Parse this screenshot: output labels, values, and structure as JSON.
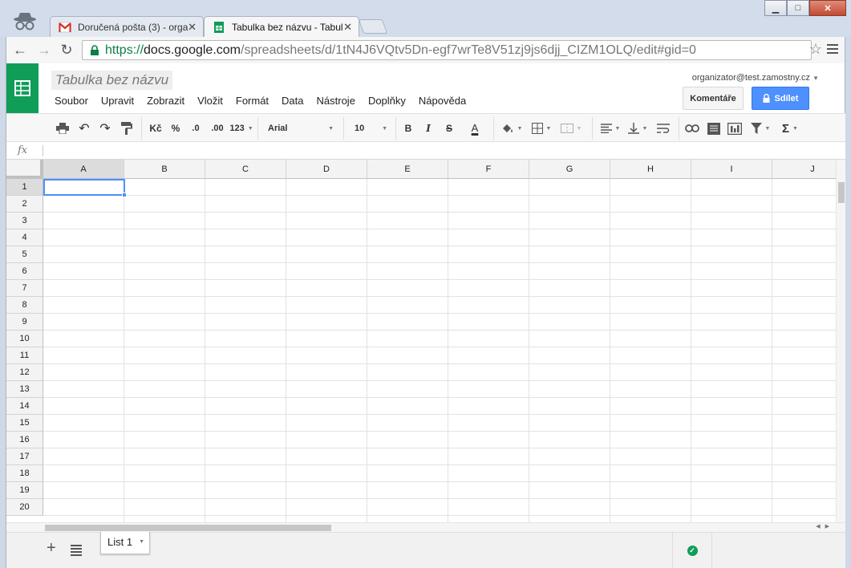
{
  "browser": {
    "tabs": [
      {
        "title": "Doručená pošta (3) - orga",
        "favicon": "gmail-icon"
      },
      {
        "title": "Tabulka bez názvu - Tabul",
        "favicon": "sheets-icon"
      }
    ],
    "url": {
      "scheme": "https://",
      "host": "docs.google.com",
      "path": "/spreadsheets/d/1tN4J6VQtv5Dn-egf7wrTe8V51zj9js6djj_CIZM1OLQ/edit#gid=0"
    }
  },
  "app": {
    "doc_title": "Tabulka bez názvu",
    "menu": [
      "Soubor",
      "Upravit",
      "Zobrazit",
      "Vložit",
      "Formát",
      "Data",
      "Nástroje",
      "Doplňky",
      "Nápověda"
    ],
    "account": "organizator@test.zamostny.cz",
    "comments_label": "Komentáře",
    "share_label": "Sdílet",
    "accent_color": "#0f9d58",
    "share_color": "#4d90fe"
  },
  "toolbar": {
    "currency": "Kč",
    "percent": "%",
    "decimal_decrease": ".0",
    "decimal_increase": ".00",
    "more_formats": "123",
    "font": "Arial",
    "font_size": "10",
    "bold": "B",
    "italic": "I",
    "strike": "S",
    "text_color": "A",
    "sum": "Σ"
  },
  "formula_bar": {
    "fx_label": "fx",
    "value": ""
  },
  "grid": {
    "columns": [
      "A",
      "B",
      "C",
      "D",
      "E",
      "F",
      "G",
      "H",
      "I",
      "J"
    ],
    "rows": [
      "1",
      "2",
      "3",
      "4",
      "5",
      "6",
      "7",
      "8",
      "9",
      "10",
      "11",
      "12",
      "13",
      "14",
      "15",
      "16",
      "17",
      "18",
      "19",
      "20"
    ],
    "active_cell": "A1"
  },
  "sheets": {
    "tabs": [
      "List 1"
    ]
  }
}
